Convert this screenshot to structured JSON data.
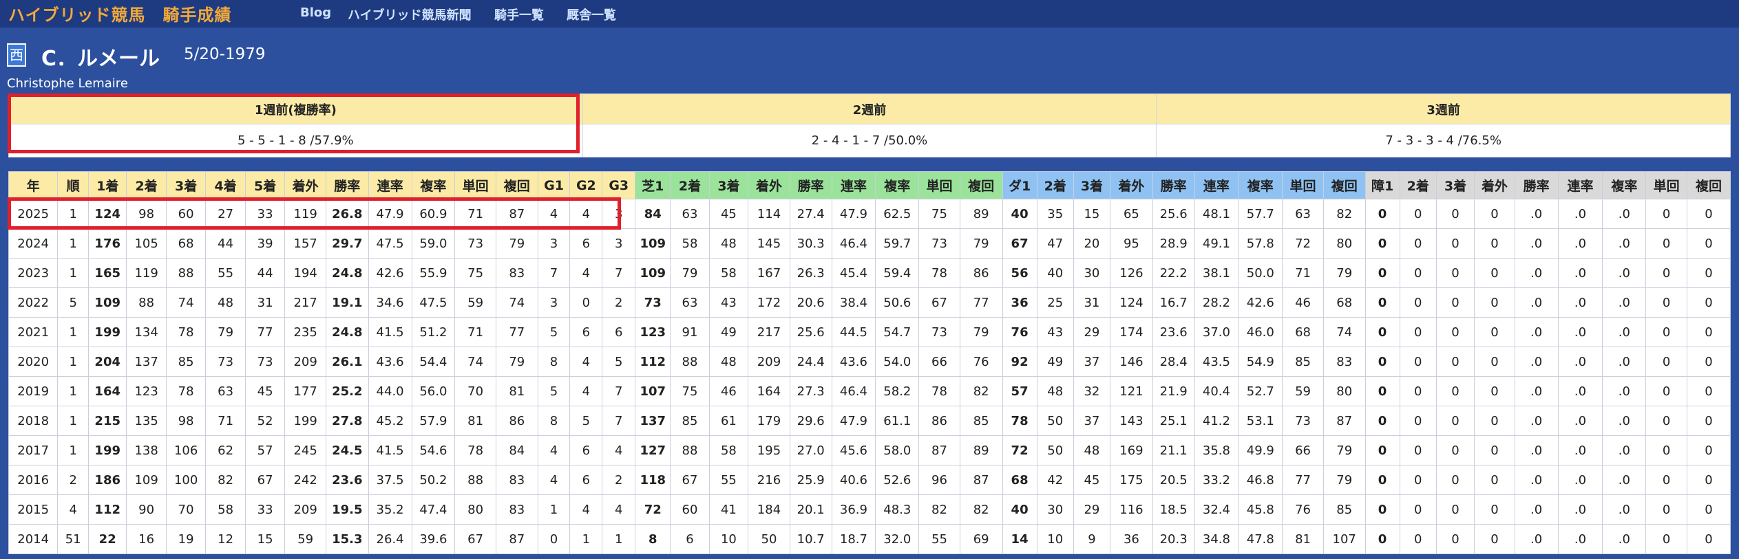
{
  "site_title": "ハイブリッド競馬　騎手成績",
  "nav": [
    "Blog",
    "ハイブリッド競馬新聞",
    "騎手一覧",
    "厩舎一覧"
  ],
  "jockey": {
    "badge": "西",
    "name": "C．ルメール",
    "birth": "5/20-1979",
    "name_en": "Christophe Lemaire"
  },
  "weeks": {
    "headers": [
      "1週前(複勝率)",
      "2週前",
      "3週前"
    ],
    "values": [
      "5 - 5 - 1 - 8 /57.9%",
      "2 - 4 - 1 - 7 /50.0%",
      "7 - 3 - 3 - 4 /76.5%"
    ]
  },
  "table": {
    "headers": [
      "年",
      "順",
      "1着",
      "2着",
      "3着",
      "4着",
      "5着",
      "着外",
      "勝率",
      "連率",
      "複率",
      "単回",
      "複回",
      "G1",
      "G2",
      "G3",
      "芝1",
      "2着",
      "3着",
      "着外",
      "勝率",
      "連率",
      "複率",
      "単回",
      "複回",
      "ダ1",
      "2着",
      "3着",
      "着外",
      "勝率",
      "連率",
      "複率",
      "単回",
      "複回",
      "障1",
      "2着",
      "3着",
      "着外",
      "勝率",
      "連率",
      "複率",
      "単回",
      "複回"
    ],
    "rows": [
      [
        "2025",
        "1",
        "124",
        "98",
        "60",
        "27",
        "33",
        "119",
        "26.8",
        "47.9",
        "60.9",
        "71",
        "87",
        "4",
        "4",
        "3",
        "84",
        "63",
        "45",
        "114",
        "27.4",
        "47.9",
        "62.5",
        "75",
        "89",
        "40",
        "35",
        "15",
        "65",
        "25.6",
        "48.1",
        "57.7",
        "63",
        "82",
        "0",
        "0",
        "0",
        "0",
        ".0",
        ".0",
        ".0",
        "0",
        "0"
      ],
      [
        "2024",
        "1",
        "176",
        "105",
        "68",
        "44",
        "39",
        "157",
        "29.7",
        "47.5",
        "59.0",
        "73",
        "79",
        "3",
        "6",
        "3",
        "109",
        "58",
        "48",
        "145",
        "30.3",
        "46.4",
        "59.7",
        "73",
        "79",
        "67",
        "47",
        "20",
        "95",
        "28.9",
        "49.1",
        "57.8",
        "72",
        "80",
        "0",
        "0",
        "0",
        "0",
        ".0",
        ".0",
        ".0",
        "0",
        "0"
      ],
      [
        "2023",
        "1",
        "165",
        "119",
        "88",
        "55",
        "44",
        "194",
        "24.8",
        "42.6",
        "55.9",
        "75",
        "83",
        "7",
        "4",
        "7",
        "109",
        "79",
        "58",
        "167",
        "26.3",
        "45.4",
        "59.4",
        "78",
        "86",
        "56",
        "40",
        "30",
        "126",
        "22.2",
        "38.1",
        "50.0",
        "71",
        "79",
        "0",
        "0",
        "0",
        "0",
        ".0",
        ".0",
        ".0",
        "0",
        "0"
      ],
      [
        "2022",
        "5",
        "109",
        "88",
        "74",
        "48",
        "31",
        "217",
        "19.1",
        "34.6",
        "47.5",
        "59",
        "74",
        "3",
        "0",
        "2",
        "73",
        "63",
        "43",
        "172",
        "20.6",
        "38.4",
        "50.6",
        "67",
        "77",
        "36",
        "25",
        "31",
        "124",
        "16.7",
        "28.2",
        "42.6",
        "46",
        "68",
        "0",
        "0",
        "0",
        "0",
        ".0",
        ".0",
        ".0",
        "0",
        "0"
      ],
      [
        "2021",
        "1",
        "199",
        "134",
        "78",
        "79",
        "77",
        "235",
        "24.8",
        "41.5",
        "51.2",
        "71",
        "77",
        "5",
        "6",
        "6",
        "123",
        "91",
        "49",
        "217",
        "25.6",
        "44.5",
        "54.7",
        "73",
        "79",
        "76",
        "43",
        "29",
        "174",
        "23.6",
        "37.0",
        "46.0",
        "68",
        "74",
        "0",
        "0",
        "0",
        "0",
        ".0",
        ".0",
        ".0",
        "0",
        "0"
      ],
      [
        "2020",
        "1",
        "204",
        "137",
        "85",
        "73",
        "73",
        "209",
        "26.1",
        "43.6",
        "54.4",
        "74",
        "79",
        "8",
        "4",
        "5",
        "112",
        "88",
        "48",
        "209",
        "24.4",
        "43.6",
        "54.0",
        "66",
        "76",
        "92",
        "49",
        "37",
        "146",
        "28.4",
        "43.5",
        "54.9",
        "85",
        "83",
        "0",
        "0",
        "0",
        "0",
        ".0",
        ".0",
        ".0",
        "0",
        "0"
      ],
      [
        "2019",
        "1",
        "164",
        "123",
        "78",
        "63",
        "45",
        "177",
        "25.2",
        "44.0",
        "56.0",
        "70",
        "81",
        "5",
        "4",
        "7",
        "107",
        "75",
        "46",
        "164",
        "27.3",
        "46.4",
        "58.2",
        "78",
        "82",
        "57",
        "48",
        "32",
        "121",
        "21.9",
        "40.4",
        "52.7",
        "59",
        "80",
        "0",
        "0",
        "0",
        "0",
        ".0",
        ".0",
        ".0",
        "0",
        "0"
      ],
      [
        "2018",
        "1",
        "215",
        "135",
        "98",
        "71",
        "52",
        "199",
        "27.8",
        "45.2",
        "57.9",
        "81",
        "86",
        "8",
        "5",
        "7",
        "137",
        "85",
        "61",
        "179",
        "29.6",
        "47.9",
        "61.1",
        "86",
        "85",
        "78",
        "50",
        "37",
        "143",
        "25.1",
        "41.2",
        "53.1",
        "73",
        "87",
        "0",
        "0",
        "0",
        "0",
        ".0",
        ".0",
        ".0",
        "0",
        "0"
      ],
      [
        "2017",
        "1",
        "199",
        "138",
        "106",
        "62",
        "57",
        "245",
        "24.5",
        "41.5",
        "54.6",
        "78",
        "84",
        "4",
        "6",
        "4",
        "127",
        "88",
        "58",
        "195",
        "27.0",
        "45.6",
        "58.0",
        "87",
        "89",
        "72",
        "50",
        "48",
        "169",
        "21.1",
        "35.8",
        "49.9",
        "66",
        "79",
        "0",
        "0",
        "0",
        "0",
        ".0",
        ".0",
        ".0",
        "0",
        "0"
      ],
      [
        "2016",
        "2",
        "186",
        "109",
        "100",
        "82",
        "67",
        "242",
        "23.6",
        "37.5",
        "50.2",
        "88",
        "83",
        "4",
        "6",
        "2",
        "118",
        "67",
        "55",
        "216",
        "25.9",
        "40.6",
        "52.6",
        "96",
        "87",
        "68",
        "42",
        "45",
        "175",
        "20.5",
        "33.2",
        "46.8",
        "77",
        "79",
        "0",
        "0",
        "0",
        "0",
        ".0",
        ".0",
        ".0",
        "0",
        "0"
      ],
      [
        "2015",
        "4",
        "112",
        "90",
        "70",
        "58",
        "33",
        "209",
        "19.5",
        "35.2",
        "47.4",
        "80",
        "83",
        "1",
        "4",
        "4",
        "72",
        "60",
        "41",
        "184",
        "20.1",
        "36.9",
        "48.3",
        "82",
        "82",
        "40",
        "30",
        "29",
        "116",
        "18.5",
        "32.4",
        "45.8",
        "76",
        "85",
        "0",
        "0",
        "0",
        "0",
        ".0",
        ".0",
        ".0",
        "0",
        "0"
      ],
      [
        "2014",
        "51",
        "22",
        "16",
        "19",
        "12",
        "15",
        "59",
        "15.3",
        "26.4",
        "39.6",
        "67",
        "87",
        "0",
        "1",
        "1",
        "8",
        "6",
        "10",
        "50",
        "10.7",
        "18.7",
        "32.0",
        "55",
        "69",
        "14",
        "10",
        "9",
        "36",
        "20.3",
        "34.8",
        "47.8",
        "81",
        "107",
        "0",
        "0",
        "0",
        "0",
        ".0",
        ".0",
        ".0",
        "0",
        "0"
      ]
    ]
  },
  "colors": {
    "page_bg": "#2c4f9e",
    "topbar_bg": "#1e3a80",
    "site_title": "#f2a93b",
    "header_yellow": "#fbeba6",
    "turf_green": "#9be39b",
    "dirt_blue": "#8fc2f2",
    "jump_gray": "#d9d9d9",
    "highlight_red": "#e0202c"
  }
}
